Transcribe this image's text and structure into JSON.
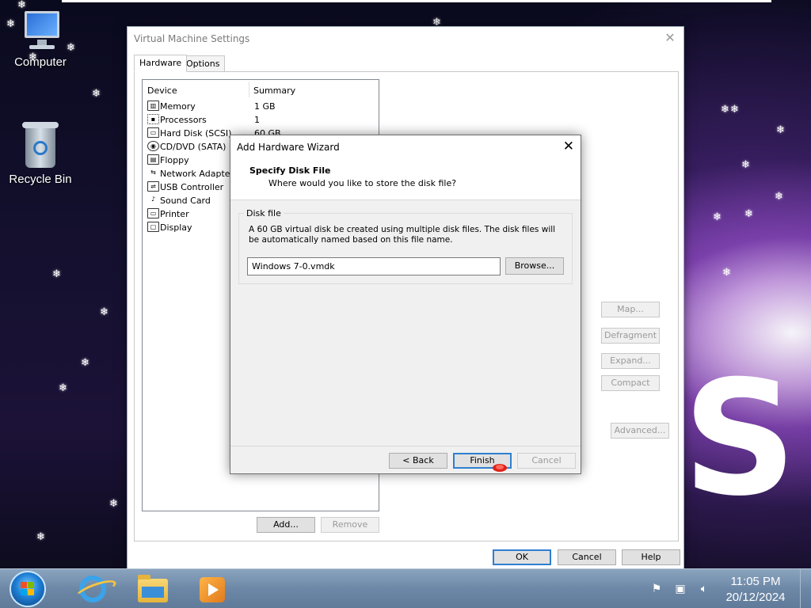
{
  "desktop": {
    "icons": [
      {
        "label": "Computer",
        "icon": "computer-icon"
      },
      {
        "label": "Recycle Bin",
        "icon": "recycle-bin-icon"
      }
    ]
  },
  "vm_settings": {
    "title": "Virtual Machine Settings",
    "tabs": [
      "Hardware",
      "Options"
    ],
    "active_tab": "Hardware",
    "columns": {
      "device": "Device",
      "summary": "Summary"
    },
    "devices": [
      {
        "name": "Memory",
        "summary": "1 GB",
        "icon": "memory-icon"
      },
      {
        "name": "Processors",
        "summary": "1",
        "icon": "processor-icon"
      },
      {
        "name": "Hard Disk (SCSI)",
        "summary": "60 GB",
        "icon": "hard-disk-icon"
      },
      {
        "name": "CD/DVD (SATA)",
        "summary": "",
        "icon": "cd-dvd-icon"
      },
      {
        "name": "Floppy",
        "summary": "",
        "icon": "floppy-icon"
      },
      {
        "name": "Network Adapter",
        "summary": "",
        "icon": "network-adapter-icon"
      },
      {
        "name": "USB Controller",
        "summary": "",
        "icon": "usb-icon"
      },
      {
        "name": "Sound Card",
        "summary": "",
        "icon": "sound-card-icon"
      },
      {
        "name": "Printer",
        "summary": "",
        "icon": "printer-icon"
      },
      {
        "name": "Display",
        "summary": "",
        "icon": "display-icon"
      }
    ],
    "side_buttons": {
      "map": "Map...",
      "defragment": "Defragment",
      "expand": "Expand...",
      "compact": "Compact",
      "advanced": "Advanced..."
    },
    "list_buttons": {
      "add": "Add...",
      "remove": "Remove"
    },
    "footer_buttons": {
      "ok": "OK",
      "cancel": "Cancel",
      "help": "Help"
    }
  },
  "wizard": {
    "title": "Add Hardware Wizard",
    "heading": "Specify Disk File",
    "subheading": "Where would you like to store the disk file?",
    "group_label": "Disk file",
    "description": "A 60 GB virtual disk be created using multiple disk files. The disk files will be automatically named based on this file name.",
    "file_name": "Windows 7-0.vmdk",
    "browse_label": "Browse...",
    "back_label": "< Back",
    "finish_label": "Finish",
    "cancel_label": "Cancel"
  },
  "taskbar": {
    "apps": [
      "internet-explorer-icon",
      "file-explorer-icon",
      "media-player-icon"
    ],
    "clock_time": "11:05 PM",
    "clock_date": "20/12/2024"
  }
}
